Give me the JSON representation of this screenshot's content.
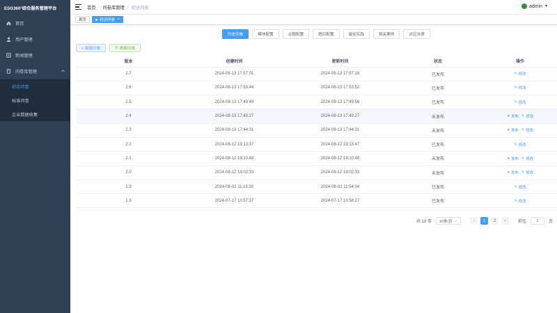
{
  "app_title": "ESG360°综合服务管理平台",
  "sidebar": {
    "items": [
      {
        "label": "首页",
        "icon": "home-icon"
      },
      {
        "label": "用户管理",
        "icon": "user-icon"
      },
      {
        "label": "新闻管理",
        "icon": "news-icon"
      },
      {
        "label": "问卷库管理",
        "icon": "questionnaire-icon"
      }
    ],
    "subitems": [
      {
        "label": "初访问卷",
        "active": true
      },
      {
        "label": "标准问卷",
        "active": false
      },
      {
        "label": "企业数据收集",
        "active": false
      }
    ]
  },
  "navbar": {
    "breadcrumb": [
      "首页",
      "问卷库管理",
      "初访问卷"
    ],
    "separator": "/",
    "user": "admin"
  },
  "tagsview": {
    "tags": [
      {
        "label": "首页",
        "active": false
      },
      {
        "label": "初访问卷",
        "active": true
      }
    ]
  },
  "top_tabs": [
    "历史问卷",
    "模块配置",
    "议题配置",
    "题目配置",
    "最佳实践",
    "相关案例",
    "对应法律"
  ],
  "actions": {
    "add": "+ 新增问卷",
    "refresh": "刷新问卷"
  },
  "table": {
    "headers": [
      "版本",
      "创建时间",
      "更新时间",
      "状态",
      "操作"
    ],
    "rows": [
      {
        "version": "2.7",
        "created": "2024-08-13 17:57:01",
        "updated": "2024-08-13 17:57:18",
        "status": "已发布",
        "ops": [
          "修改"
        ]
      },
      {
        "version": "2.6",
        "created": "2024-08-13 17:53:44",
        "updated": "2024-08-13 17:53:52",
        "status": "已发布",
        "ops": [
          "修改"
        ]
      },
      {
        "version": "2.5",
        "created": "2024-08-13 17:49:49",
        "updated": "2024-08-13 17:49:56",
        "status": "已发布",
        "ops": [
          "修改"
        ]
      },
      {
        "version": "2.4",
        "created": "2024-08-13 17:49:27",
        "updated": "2024-08-13 17:49:27",
        "status": "未发布",
        "ops": [
          "发布",
          "修改"
        ]
      },
      {
        "version": "2.3",
        "created": "2024-08-13 17:44:31",
        "updated": "2024-08-13 17:44:31",
        "status": "未发布",
        "ops": [
          "发布",
          "修改"
        ]
      },
      {
        "version": "2.2",
        "created": "2024-08-12 19:13:37",
        "updated": "2024-08-12 19:13:47",
        "status": "已发布",
        "ops": [
          "修改"
        ]
      },
      {
        "version": "2.1",
        "created": "2024-08-12 19:10:48",
        "updated": "2024-08-12 19:10:48",
        "status": "未发布",
        "ops": [
          "发布",
          "修改"
        ]
      },
      {
        "version": "2.0",
        "created": "2024-08-12 19:02:33",
        "updated": "2024-08-12 19:02:33",
        "status": "未发布",
        "ops": [
          "发布",
          "修改"
        ]
      },
      {
        "version": "1.9",
        "created": "2024-08-02 11:15:30",
        "updated": "2024-08-02 11:54:04",
        "status": "已发布",
        "ops": [
          "修改"
        ]
      },
      {
        "version": "1.8",
        "created": "2024-07-17 10:57:37",
        "updated": "2024-07-17 10:58:27",
        "status": "已发布",
        "ops": [
          "修改"
        ]
      }
    ]
  },
  "pagination": {
    "total": "共 18 条",
    "page_size": "10条/页",
    "pages": [
      "1",
      "2"
    ],
    "current": "1",
    "goto_prefix": "前往",
    "goto_value": "1",
    "goto_suffix": "页"
  },
  "colors": {
    "sidebar_bg": "#304156",
    "submenu_bg": "#1f2d3d",
    "primary": "#409eff",
    "success": "#67c23a"
  }
}
